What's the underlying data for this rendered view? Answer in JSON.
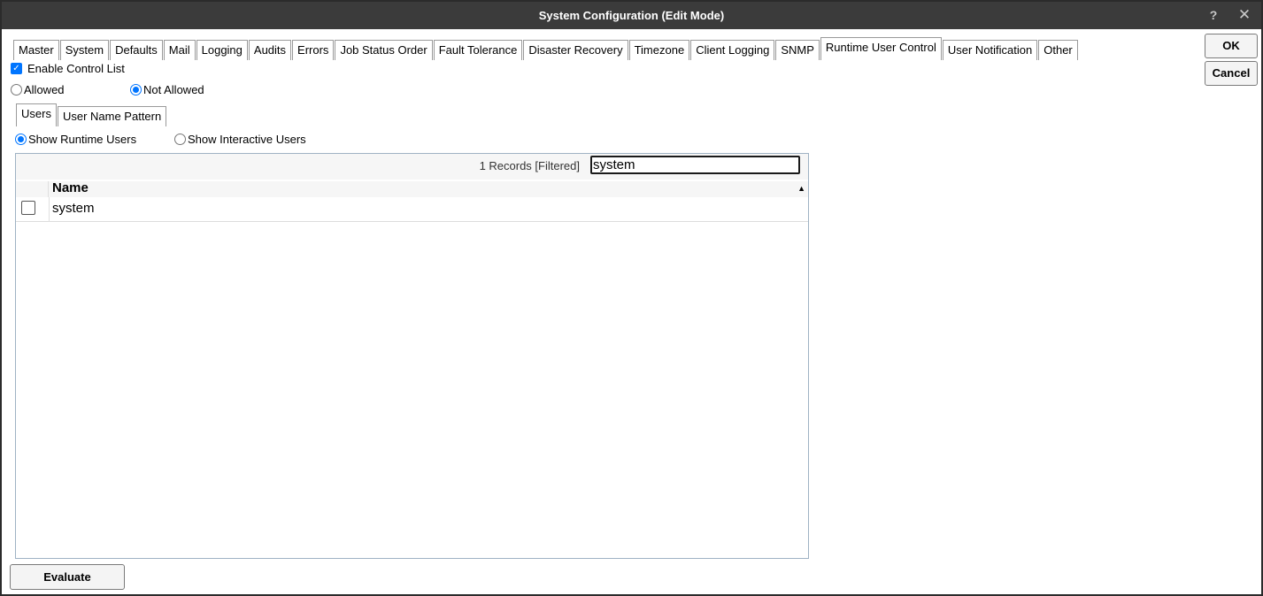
{
  "window": {
    "title": "System Configuration (Edit Mode)",
    "help_glyph": "?",
    "close_glyph": "✕"
  },
  "tabs": [
    {
      "label": "Master",
      "active": false
    },
    {
      "label": "System",
      "active": false
    },
    {
      "label": "Defaults",
      "active": false
    },
    {
      "label": "Mail",
      "active": false
    },
    {
      "label": "Logging",
      "active": false
    },
    {
      "label": "Audits",
      "active": false
    },
    {
      "label": "Errors",
      "active": false
    },
    {
      "label": "Job Status Order",
      "active": false
    },
    {
      "label": "Fault Tolerance",
      "active": false
    },
    {
      "label": "Disaster Recovery",
      "active": false
    },
    {
      "label": "Timezone",
      "active": false
    },
    {
      "label": "Client Logging",
      "active": false
    },
    {
      "label": "SNMP",
      "active": false
    },
    {
      "label": "Runtime User Control",
      "active": true
    },
    {
      "label": "User Notification",
      "active": false
    },
    {
      "label": "Other",
      "active": false
    }
  ],
  "actions": {
    "ok_label": "OK",
    "cancel_label": "Cancel",
    "evaluate_label": "Evaluate"
  },
  "control": {
    "enable_label": "Enable Control List",
    "enable_checked": true,
    "allowed_label": "Allowed",
    "not_allowed_label": "Not Allowed",
    "mode_selected": "Not Allowed"
  },
  "subtabs": [
    {
      "label": "Users",
      "active": true
    },
    {
      "label": "User Name Pattern",
      "active": false
    }
  ],
  "user_type": {
    "runtime_label": "Show Runtime Users",
    "interactive_label": "Show Interactive Users",
    "selected": "Show Runtime Users"
  },
  "grid": {
    "records_text": "1 Records [Filtered]",
    "filter_value": "system",
    "column_name": "Name",
    "sort_glyph": "▲",
    "rows": [
      {
        "name": "system",
        "checked": false
      }
    ]
  },
  "colors": {
    "titlebar": "#3b3b3b",
    "accent": "#0075ff",
    "grid_border": "#9fb2c4"
  }
}
